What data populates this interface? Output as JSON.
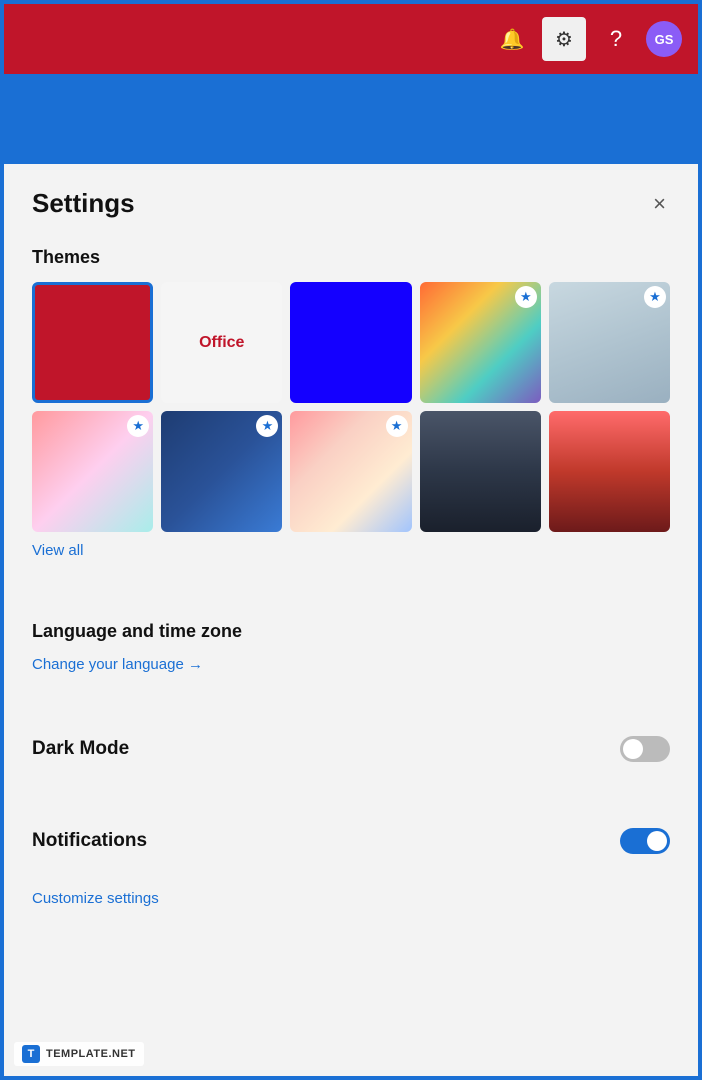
{
  "header": {
    "bell_icon": "🔔",
    "gear_icon": "⚙",
    "help_icon": "?",
    "avatar_label": "GS",
    "bg_color": "#c0152a"
  },
  "settings": {
    "title": "Settings",
    "close_label": "×",
    "themes_label": "Themes",
    "view_all_label": "View all",
    "language_section_label": "Language and time zone",
    "language_link_label": "Change your language →",
    "dark_mode_label": "Dark Mode",
    "dark_mode_on": false,
    "notifications_label": "Notifications",
    "notifications_on": true,
    "customize_label": "Customize settings"
  },
  "themes": [
    {
      "id": "red",
      "label": "",
      "selected": true
    },
    {
      "id": "office",
      "label": "Office",
      "selected": false
    },
    {
      "id": "blue",
      "label": "",
      "selected": false
    },
    {
      "id": "rainbow",
      "label": "",
      "selected": false,
      "star": true
    },
    {
      "id": "fabric",
      "label": "",
      "selected": false,
      "star": true
    },
    {
      "id": "anime",
      "label": "",
      "selected": false,
      "star": true
    },
    {
      "id": "sports",
      "label": "",
      "selected": false,
      "star": true
    },
    {
      "id": "colorful",
      "label": "",
      "selected": false,
      "star": true
    },
    {
      "id": "mountains",
      "label": "",
      "selected": false
    },
    {
      "id": "sunset",
      "label": "",
      "selected": false
    }
  ],
  "watermark": {
    "icon": "T",
    "text": "TEMPLATE.NET"
  },
  "annotation": {
    "arrow_color": "#1a6fd4"
  }
}
